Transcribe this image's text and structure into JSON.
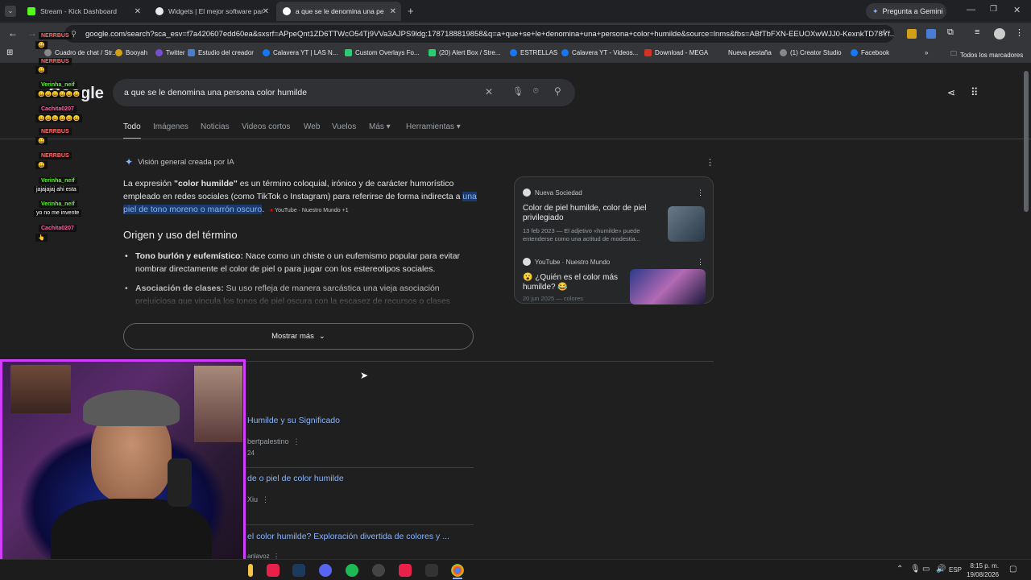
{
  "tabs": [
    {
      "title": "Stream - Kick Dashboard",
      "active": false
    },
    {
      "title": "Widgets | El mejor software par",
      "active": false
    },
    {
      "title": "a que se le denomina una persona",
      "active": true
    }
  ],
  "gemini_button": "Pregunta a Gemini",
  "url": "google.com/search?sca_esv=f7a420607edd60ea&sxsrf=APpeQnt1ZD6TTWcO54Tj9VVa3AJPS9ldg:1787188819858&q=a+que+se+le+denomina+una+persona+color+humilde&source=lnms&fbs=ABfTbFXN-EEUOXwWJJ0-KexnkTD78Yf...",
  "bookmarks": [
    "Cuadro de chat / Str...",
    "Booyah",
    "Twitter",
    "Estudio del creador",
    "Calavera YT | LAS N...",
    "Custom Overlays Fo...",
    "(20) Alert Box / Stre...",
    "ESTRELLAS",
    "Calavera YT - Videos...",
    "Download - MEGA",
    "Nueva pestaña",
    "(1) Creator Studio",
    "Facebook"
  ],
  "all_bookmarks": "Todos los marcadores",
  "search": {
    "query": "a que se le denomina una persona color humilde"
  },
  "search_tabs": [
    "Todo",
    "Imágenes",
    "Noticias",
    "Videos cortos",
    "Web",
    "Vuelos",
    "Más",
    "Herramientas"
  ],
  "ai_overview": {
    "heading": "Visión general creada por IA",
    "intro_prefix": "La expresión ",
    "intro_bold": "\"color humilde\"",
    "intro_rest": " es un término coloquial, irónico y de carácter humorístico empleado en redes sociales (como TikTok o Instagram) para referirse de forma indirecta a ",
    "intro_highlight": "una piel de tono moreno o marrón oscuro",
    "intro_end": ".",
    "source_chip": "YouTube · Nuestro Mundo +1",
    "section_title": "Origen y uso del término",
    "bullets": [
      {
        "bold": "Tono burlón y eufemístico:",
        "text": " Nace como un chiste o un eufemismo popular para evitar nombrar directamente el color de piel o para jugar con los estereotipos sociales."
      },
      {
        "bold": "Asociación de clases:",
        "text": " Su uso refleja de manera sarcástica una vieja asociación prejuiciosa que vincula los tonos de piel oscura con la escasez de recursos o clases sociales bajas, algo que se analiza críticamente en la literatura y artículos de"
      }
    ],
    "show_more": "Mostrar más"
  },
  "source_cards": [
    {
      "source": "Nueva Sociedad",
      "title": "Color de piel humilde, color de piel privilegiado",
      "snippet": "13 feb 2023 — El adjetivo «humilde» puede entenderse como una actitud de modestia..."
    },
    {
      "source": "YouTube",
      "channel": "Nuestro Mundo",
      "title": "😮 ¿Quién es el color más humilde? 😂",
      "snippet": "20 jun 2025 — colores"
    }
  ],
  "results": [
    {
      "title": "Humilde y su Significado",
      "meta": "bertpalestino",
      "extra": "24"
    },
    {
      "title": "de o piel de color humilde",
      "meta": "Xiu",
      "extra": ""
    },
    {
      "title": "el color humilde? Exploración divertida de colores y ...",
      "meta": "anlavoz",
      "extra": ""
    }
  ],
  "chat": [
    {
      "name": "NERRBUS",
      "msg": "😀",
      "color": "#ff6a6a"
    },
    {
      "name": "NERRBUS",
      "msg": "😀",
      "color": "#ff6a6a"
    },
    {
      "name": "Verinha_neif",
      "msg": "😀😀😀😀😀😀",
      "color": "#53fc18"
    },
    {
      "name": "Cachita0207",
      "msg": "😀😀😀😀😀😀",
      "color": "#ff5fa2"
    },
    {
      "name": "NERRBUS",
      "msg": "😀",
      "color": "#ff6a6a"
    },
    {
      "name": "NERRBUS",
      "msg": "😀",
      "color": "#ff6a6a"
    },
    {
      "name": "Verinha_neif",
      "msg": "jajajajaj ahi esta",
      "color": "#53fc18"
    },
    {
      "name": "Verinha_neif",
      "msg": "yo no me invente",
      "color": "#53fc18"
    },
    {
      "name": "Cachita0207",
      "msg": "👆",
      "color": "#ff5fa2"
    }
  ],
  "tray": {
    "lang": "ESP",
    "time": "8:15 p. m.",
    "date": "19/08/2026"
  },
  "colors": {
    "accent": "#8ab4f8",
    "webcam_border": "#d13cff",
    "kick_green": "#53fc18"
  }
}
